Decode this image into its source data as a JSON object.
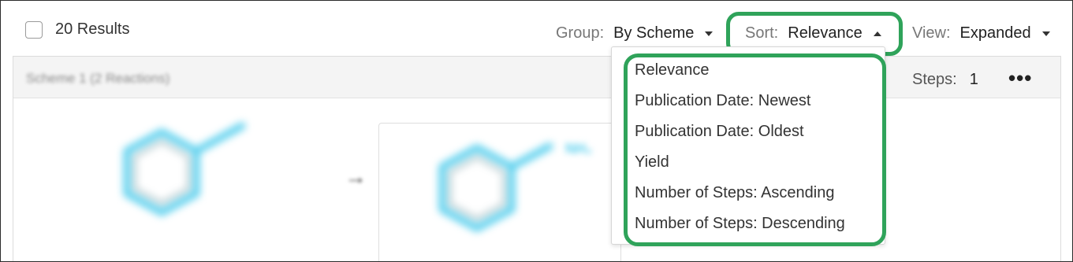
{
  "results": {
    "count_label": "20 Results"
  },
  "toolbar": {
    "group_label": "Group:",
    "group_value": "By Scheme",
    "sort_label": "Sort:",
    "sort_value": "Relevance",
    "view_label": "View:",
    "view_value": "Expanded"
  },
  "scheme": {
    "title": "Scheme 1  (2 Reactions)",
    "steps_label": "Steps:",
    "steps_value": "1",
    "more_icon": "•••",
    "arrow_icon": "→",
    "product_label": "NH₂"
  },
  "sort_menu": {
    "items": [
      "Relevance",
      "Publication Date: Newest",
      "Publication Date: Oldest",
      "Yield",
      "Number of Steps: Ascending",
      "Number of Steps: Descending"
    ]
  },
  "colors": {
    "highlight": "#2fa35a",
    "molecule": "#5ad0ee"
  }
}
